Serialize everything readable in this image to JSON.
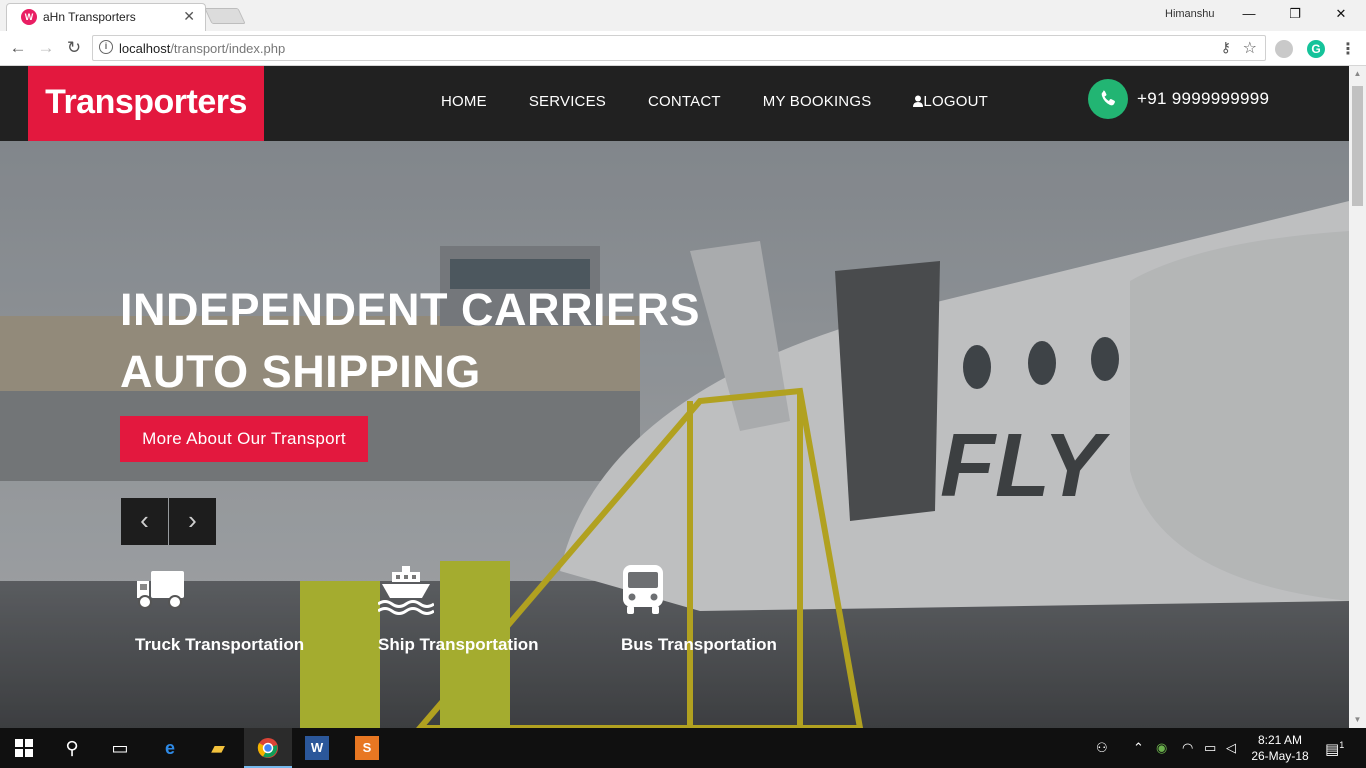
{
  "browser": {
    "tab": {
      "title": "aHn Transporters",
      "close": "✕"
    },
    "profile_name": "Himanshu",
    "window": {
      "minimize": "—",
      "restore": "❐",
      "close": "✕"
    },
    "url_host": "localhost",
    "url_path": "/transport/index.php"
  },
  "site": {
    "logo": "Transporters",
    "nav": [
      "HOME",
      "SERVICES",
      "CONTACT",
      "MY BOOKINGS",
      "LOGOUT"
    ],
    "phone": "+91 9999999999"
  },
  "hero": {
    "headline_line1": "INDEPENDENT CARRIERS",
    "headline_line2": "AUTO SHIPPING",
    "cta": "More About Our Transport",
    "prev": "‹",
    "next": "›",
    "services": [
      {
        "label": "Truck Transportation",
        "icon": "truck-icon"
      },
      {
        "label": "Ship Transportation",
        "icon": "ship-icon"
      },
      {
        "label": "Bus Transportation",
        "icon": "bus-icon"
      }
    ]
  },
  "taskbar": {
    "time": "8:21 AM",
    "date": "26-May-18",
    "notification_count": "1"
  },
  "colors": {
    "brand_red": "#e3183e",
    "phone_green": "#22b573",
    "header_dark": "#212121"
  }
}
